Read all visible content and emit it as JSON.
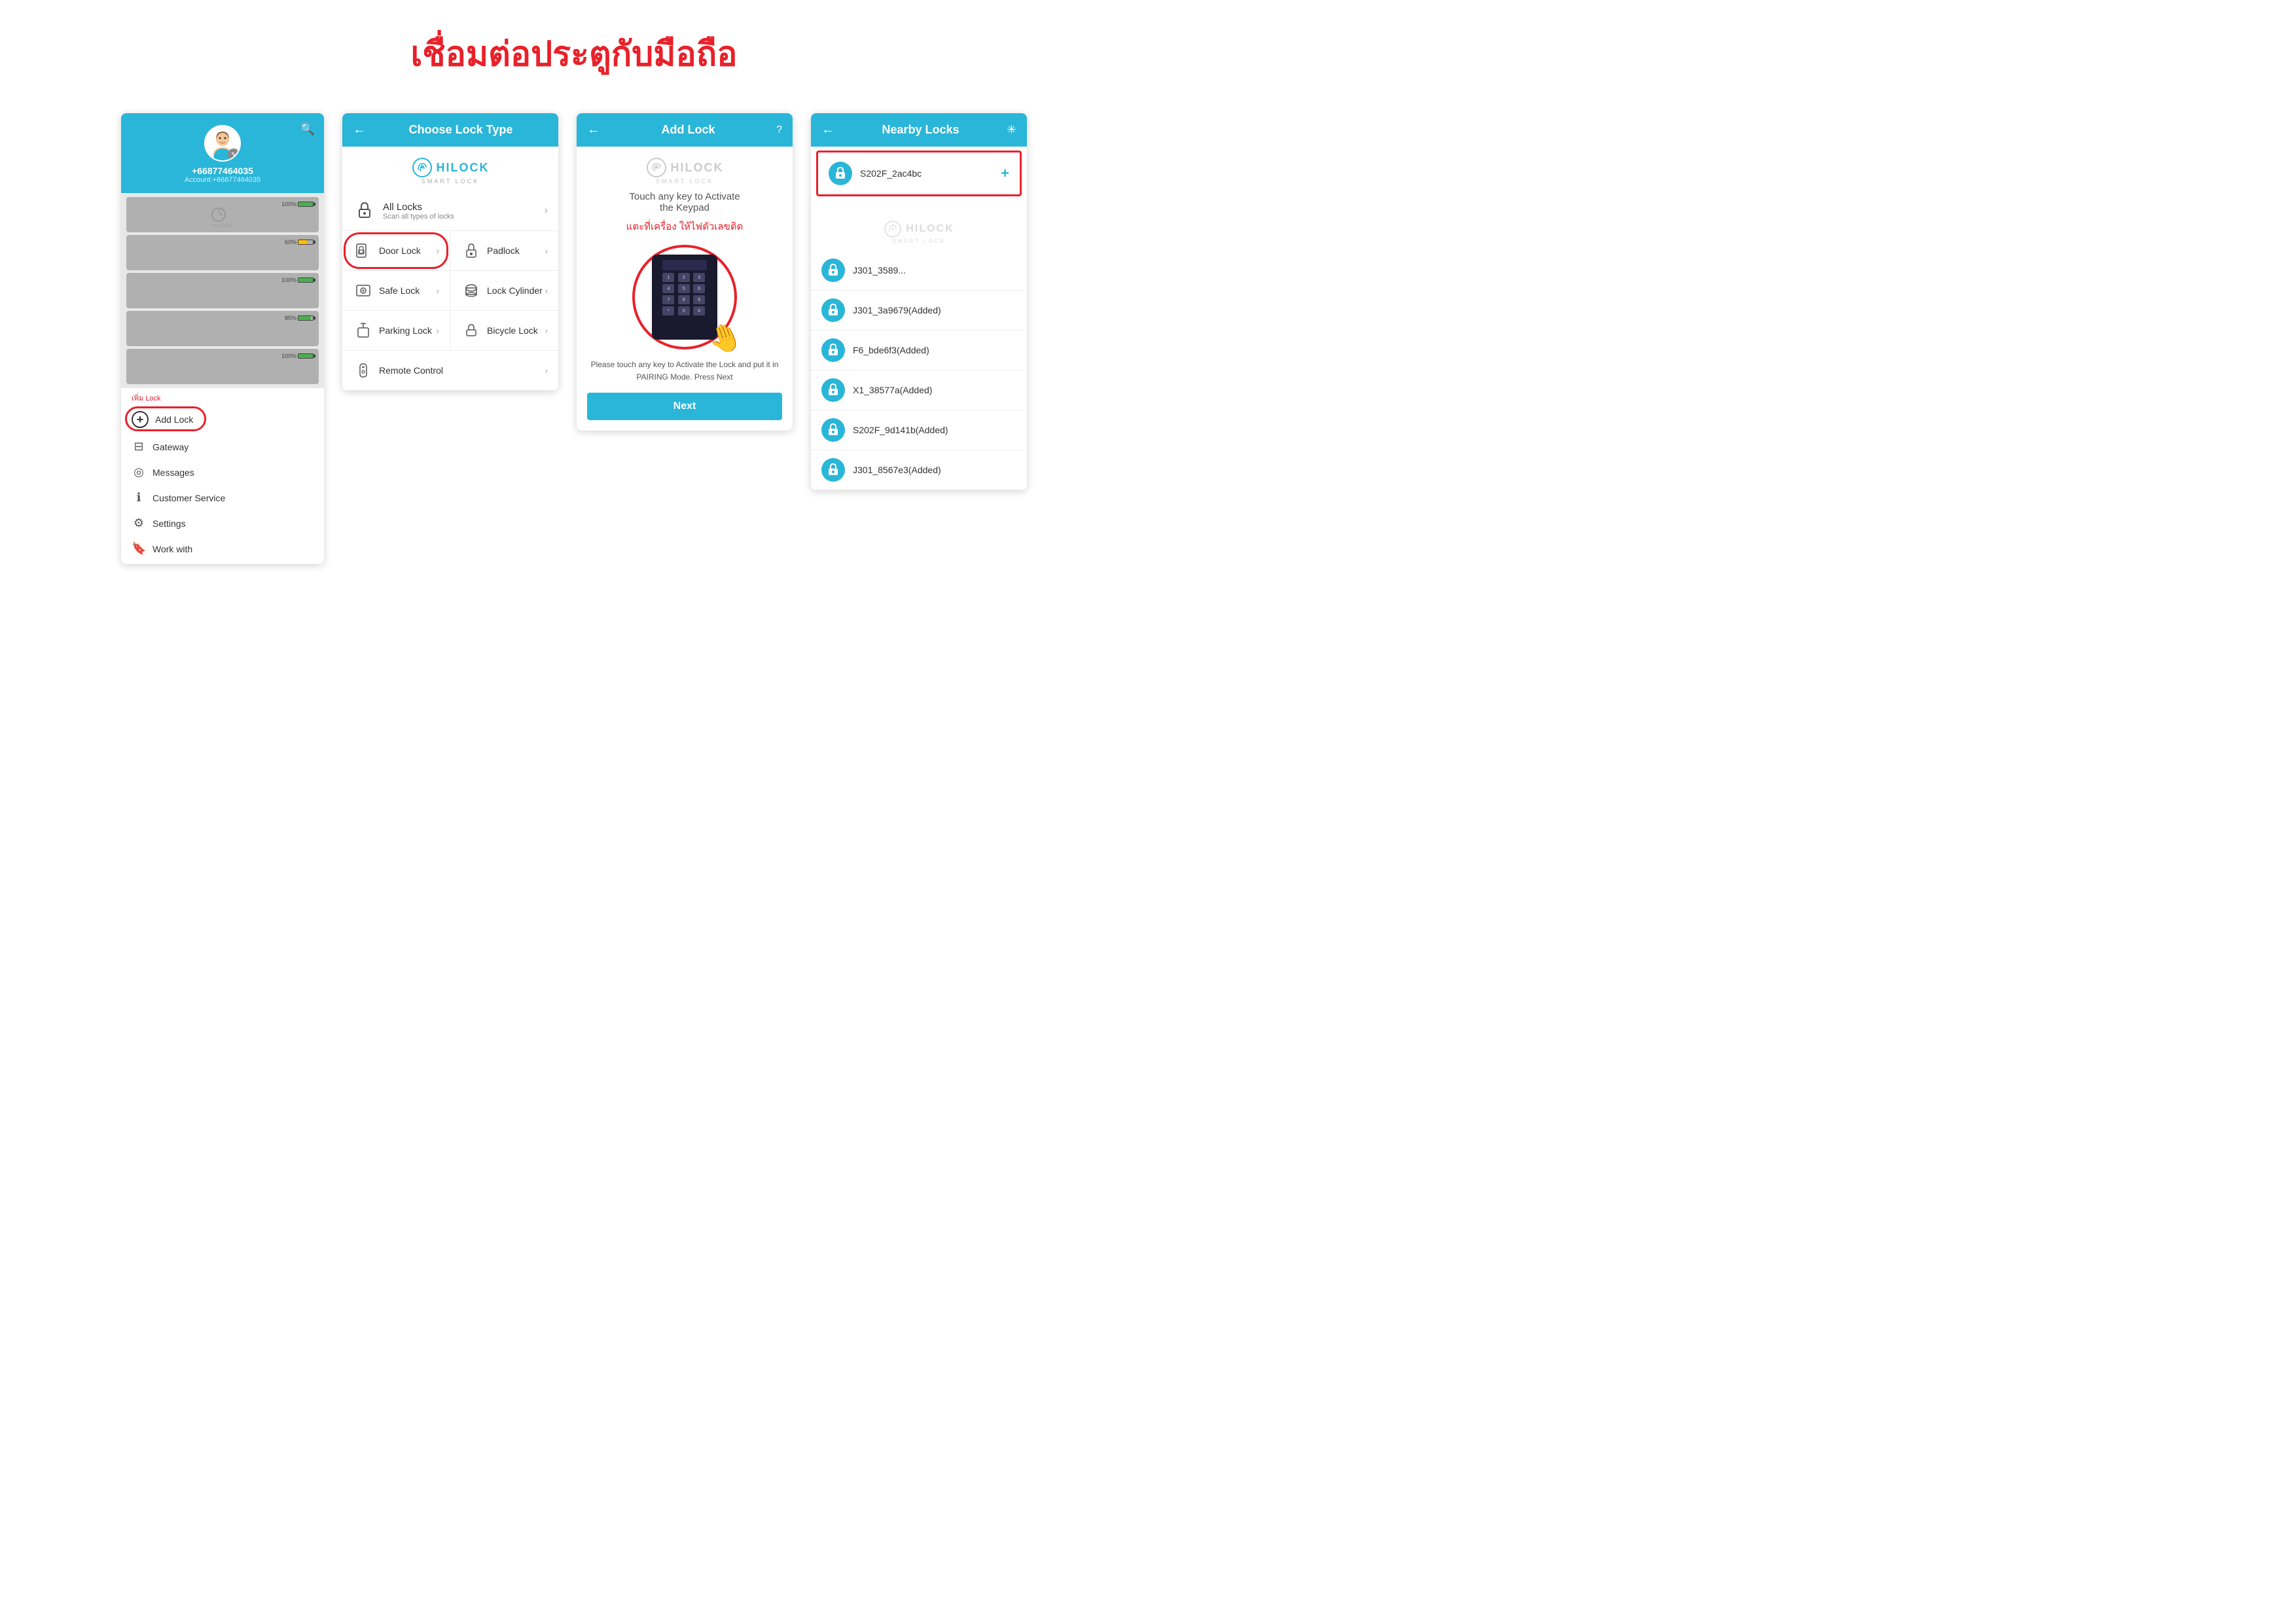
{
  "page": {
    "title": "เชื่อมต่อประตูกับมือถือ"
  },
  "screen1": {
    "phone": "+66877464035",
    "account_label": "Account:+66877464035",
    "add_lock_label": "เพิ่ม Lock",
    "menu_items": [
      {
        "id": "add-lock",
        "icon": "+",
        "label": "Add Lock"
      },
      {
        "id": "gateway",
        "icon": "⊟",
        "label": "Gateway"
      },
      {
        "id": "messages",
        "icon": "◎",
        "label": "Messages"
      },
      {
        "id": "customer-service",
        "icon": "ℹ",
        "label": "Customer Service"
      },
      {
        "id": "settings",
        "icon": "⚙",
        "label": "Settings"
      },
      {
        "id": "work-with",
        "icon": "🔖",
        "label": "Work with"
      }
    ],
    "battery_levels": [
      "100%",
      "60%",
      "100%",
      "85%",
      "100%"
    ]
  },
  "screen2": {
    "header_title": "Choose Lock Type",
    "hilock_brand": "HILOCK",
    "hilock_sub": "SMART LOCK",
    "all_locks_name": "All Locks",
    "all_locks_sub": "Scan all types of locks",
    "lock_types": [
      {
        "id": "door-lock",
        "name": "Door Lock"
      },
      {
        "id": "padlock",
        "name": "Padlock"
      },
      {
        "id": "safe-lock",
        "name": "Safe Lock"
      },
      {
        "id": "lock-cylinder",
        "name": "Lock Cylinder"
      },
      {
        "id": "parking-lock",
        "name": "Parking Lock"
      },
      {
        "id": "bicycle-lock",
        "name": "Bicycle Lock"
      },
      {
        "id": "remote-control",
        "name": "Remote Control"
      }
    ]
  },
  "screen3": {
    "header_title": "Add Lock",
    "hilock_brand": "HILOCK",
    "hilock_sub": "SMART LOCK",
    "instruction_line1": "Touch any key to Activate",
    "instruction_line2": "the Keypad",
    "thai_instruction": "แตะที่เครื่อง ให้ไฟตัวเลขติด",
    "bottom_text": "Please touch any key to Activate the Lock and put it in PAIRING Mode. Press Next",
    "next_button": "Next"
  },
  "screen4": {
    "header_title": "Nearby Locks",
    "hilock_brand": "HILOCK",
    "hilock_sub": "SMART LOCK",
    "locks": [
      {
        "id": "s202f-2ac4bc",
        "name": "S202F_2ac4bc",
        "highlight": true
      },
      {
        "id": "j301-1",
        "name": "J301_3589..."
      },
      {
        "id": "j301-3a9679",
        "name": "J301_3a9679(Added)"
      },
      {
        "id": "f6-bde6f3",
        "name": "F6_bde6f3(Added)"
      },
      {
        "id": "x1-38577a",
        "name": "X1_38577a(Added)"
      },
      {
        "id": "s202f-9d141b",
        "name": "S202F_9d141b(Added)"
      },
      {
        "id": "j301-8567e3",
        "name": "J301_8567e3(Added)"
      }
    ]
  }
}
